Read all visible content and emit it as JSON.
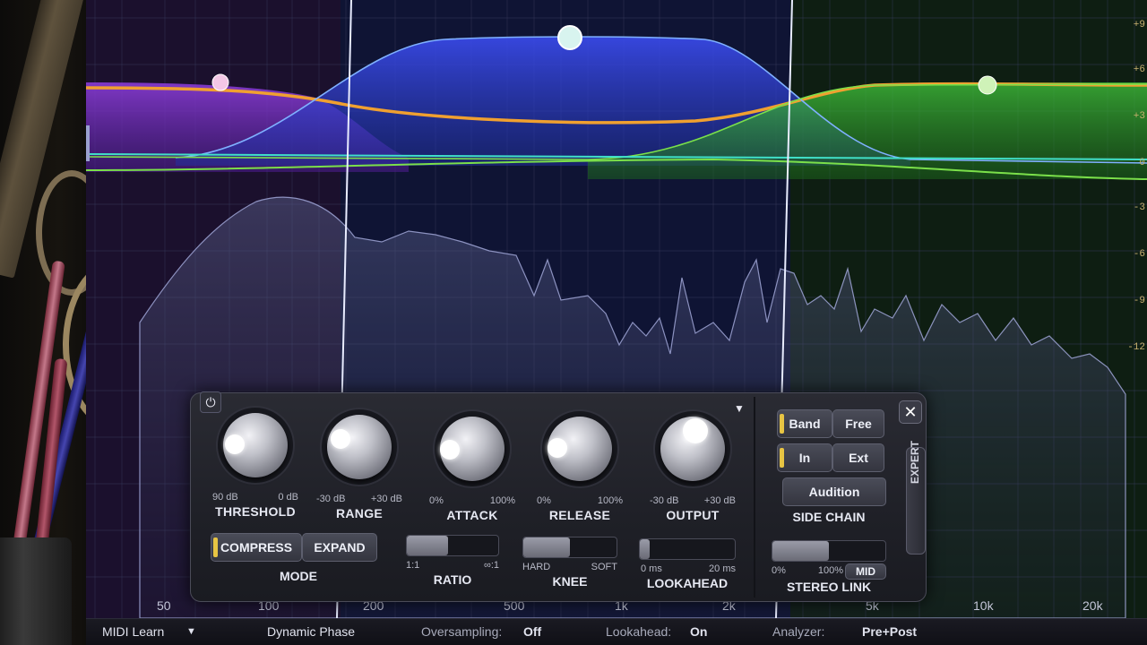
{
  "graph": {
    "db_labels": [
      "+9",
      "+6",
      "+3",
      "0",
      "-3",
      "-6",
      "-9",
      "-12"
    ],
    "freq_labels": [
      "50",
      "100",
      "200",
      "500",
      "1k",
      "2k",
      "5k",
      "10k",
      "20k"
    ]
  },
  "panel": {
    "power_icon": "power-icon",
    "close_icon": "close-icon",
    "knobs": [
      {
        "label": "THRESHOLD",
        "min": "90 dB",
        "max": "0 dB"
      },
      {
        "label": "RANGE",
        "min": "-30 dB",
        "max": "+30 dB"
      },
      {
        "label": "ATTACK",
        "min": "0%",
        "max": "100%"
      },
      {
        "label": "RELEASE",
        "min": "0%",
        "max": "100%"
      },
      {
        "label": "OUTPUT",
        "min": "-30 dB",
        "max": "+30 dB"
      }
    ],
    "mode": {
      "label": "MODE",
      "compress": "COMPRESS",
      "expand": "EXPAND",
      "selected": "COMPRESS"
    },
    "ratio": {
      "label": "RATIO",
      "min": "1:1",
      "max": "∞:1",
      "value_pct": 45
    },
    "knee": {
      "label": "KNEE",
      "min": "HARD",
      "max": "SOFT",
      "value_pct": 50
    },
    "lookahead": {
      "label": "LOOKAHEAD",
      "min": "0 ms",
      "max": "20 ms",
      "value_pct": 10
    },
    "side_chain": {
      "label": "SIDE CHAIN",
      "band": "Band",
      "free": "Free",
      "in": "In",
      "ext": "Ext",
      "audition": "Audition"
    },
    "expert": "EXPERT",
    "stereo_link": {
      "label": "STEREO LINK",
      "min": "0%",
      "max": "100%",
      "mode": "MID",
      "value_pct": 50
    }
  },
  "bottom_bar": {
    "midi_learn": "MIDI Learn",
    "phase": "Dynamic Phase",
    "oversampling_label": "Oversampling:",
    "oversampling_value": "Off",
    "lookahead_label": "Lookahead:",
    "lookahead_value": "On",
    "analyzer_label": "Analyzer:",
    "analyzer_value": "Pre+Post"
  },
  "colors": {
    "accent_yellow": "#e7c443",
    "band_purple": "#8a3cd6",
    "band_blue": "#3346e0",
    "band_green": "#3fbf3a",
    "curve_orange": "#f0a030",
    "threshold_green": "#7be04a"
  }
}
